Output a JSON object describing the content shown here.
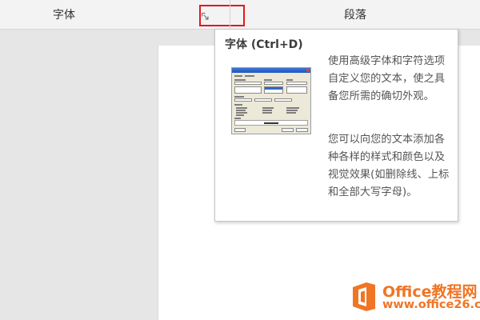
{
  "ribbon": {
    "font_group_label": "字体",
    "paragraph_group_label": "段落",
    "launcher_icon": "dialog-launcher-icon",
    "highlight_color": "#e4161f"
  },
  "tooltip": {
    "title": "字体 (Ctrl+D)",
    "paragraph1": "使用高级字体和字符选项自定义您的文本，使之具备您所需的确切外观。",
    "paragraph2": "您可以向您的文本添加各种各样的样式和颜色以及视觉效果(如删除线、上标和全部大写字母)。",
    "thumbnail_icon": "font-dialog-thumbnail"
  },
  "watermark": {
    "title": "Office教程网",
    "url": "www.office26.com",
    "icon": "office-logo-icon",
    "color": "#f07525"
  }
}
